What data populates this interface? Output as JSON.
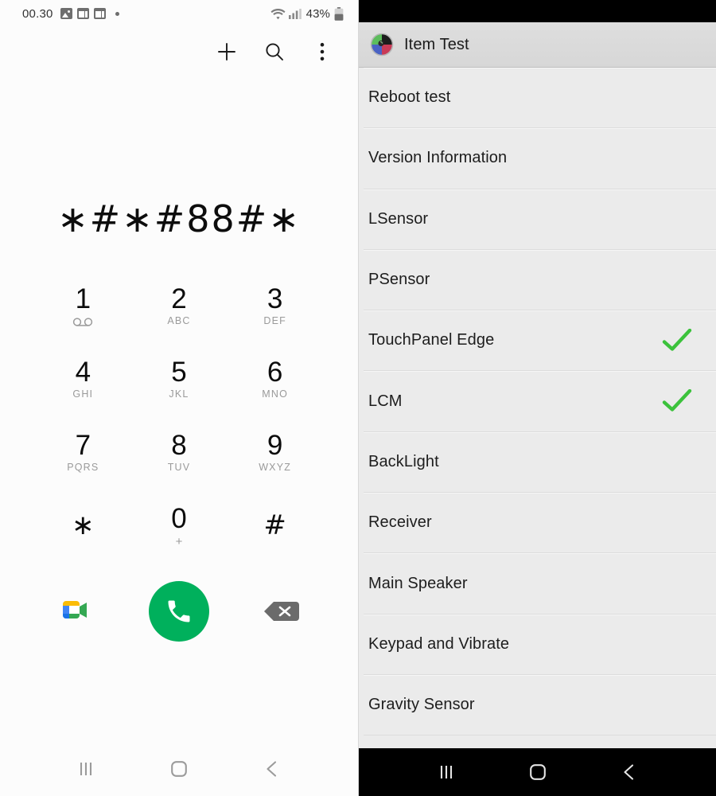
{
  "dialer": {
    "status_bar": {
      "time": "00.30",
      "notification_icons": [
        "photo-icon",
        "screenshot-icon",
        "screenshot-icon"
      ],
      "indicator_dot": "dot-indicator",
      "wifi_icon": "wifi-icon",
      "signal_icon": "signal-bars-icon",
      "battery_percent": "43%",
      "battery_icon": "battery-icon"
    },
    "toolbar": {
      "add_label": "add-contact-icon",
      "search_label": "search-icon",
      "more_label": "more-options-icon"
    },
    "entered_number": "∗#∗#88#∗",
    "keys": [
      {
        "num": "1",
        "sub": "",
        "icon": "voicemail-icon"
      },
      {
        "num": "2",
        "sub": "ABC",
        "icon": ""
      },
      {
        "num": "3",
        "sub": "DEF",
        "icon": ""
      },
      {
        "num": "4",
        "sub": "GHI",
        "icon": ""
      },
      {
        "num": "5",
        "sub": "JKL",
        "icon": ""
      },
      {
        "num": "6",
        "sub": "MNO",
        "icon": ""
      },
      {
        "num": "7",
        "sub": "PQRS",
        "icon": ""
      },
      {
        "num": "8",
        "sub": "TUV",
        "icon": ""
      },
      {
        "num": "9",
        "sub": "WXYZ",
        "icon": ""
      },
      {
        "num": "∗",
        "sub": "",
        "icon": ""
      },
      {
        "num": "0",
        "sub": "+",
        "icon": ""
      },
      {
        "num": "#",
        "sub": "",
        "icon": ""
      }
    ],
    "actions": {
      "video_call": "google-meet-icon",
      "call": "call-icon",
      "backspace": "backspace-icon",
      "call_button_color": "#00b05c"
    },
    "nav": {
      "recents": "recents-icon",
      "home": "home-icon",
      "back": "back-icon"
    }
  },
  "item_test": {
    "app_title": "Item Test",
    "app_icon": "item-test-app-icon",
    "rows": [
      {
        "label": "Reboot test",
        "checked": false
      },
      {
        "label": "Version Information",
        "checked": false
      },
      {
        "label": "LSensor",
        "checked": false
      },
      {
        "label": "PSensor",
        "checked": false
      },
      {
        "label": "TouchPanel Edge",
        "checked": true
      },
      {
        "label": "LCM",
        "checked": true
      },
      {
        "label": "BackLight",
        "checked": false
      },
      {
        "label": "Receiver",
        "checked": false
      },
      {
        "label": "Main Speaker",
        "checked": false
      },
      {
        "label": "Keypad and Vibrate",
        "checked": false
      },
      {
        "label": "Gravity Sensor",
        "checked": false
      }
    ],
    "check_color": "#3cc23c",
    "nav": {
      "recents": "recents-icon",
      "home": "home-icon",
      "back": "back-icon"
    }
  }
}
